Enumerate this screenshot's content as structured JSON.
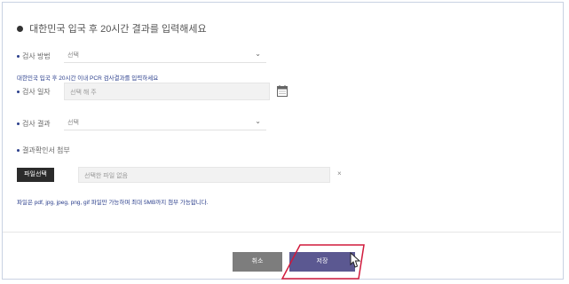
{
  "form": {
    "title": "대한민국 입국 후 20시간 결과를 입력해세요",
    "fields": [
      {
        "label": "검사 방법",
        "value": "선택"
      },
      {
        "label": "검사 일자",
        "value": "선택 해 주"
      },
      {
        "label": "검사 결과",
        "value": "선택"
      }
    ],
    "note_top": "대한민국 입국 후 20시간 이내 PCR 검사결과를 입력하세요",
    "upload_label": "결과확인서 첨부",
    "file_button": "파일선택",
    "file_placeholder": "선택한 파일 없음",
    "note_bottom": "파일은 pdf, jpg, jpeg, png, gif 파일만 가능하며 최대 5MB까지 첨부 가능합니다."
  },
  "icons": {
    "calendar": "calendar-icon",
    "dropdown": "chevron-down-icon",
    "clear": "close-icon",
    "cursor": "hand-pointer-icon"
  },
  "buttons": {
    "cancel": "취소",
    "confirm": "저장"
  },
  "colors": {
    "accent": "#2b3f8c",
    "confirm_button": "#5b5891",
    "cancel_button": "#7d7d7d",
    "highlight": "#d11a3c"
  }
}
